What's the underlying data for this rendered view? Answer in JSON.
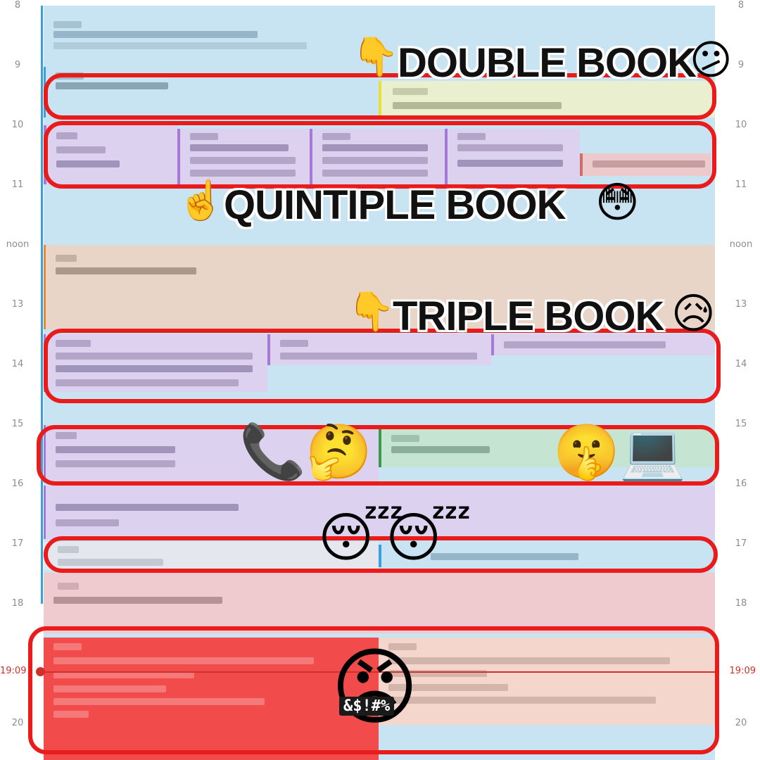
{
  "time_axis": {
    "hours": [
      "8",
      "9",
      "10",
      "11",
      "noon",
      "13",
      "14",
      "15",
      "16",
      "17",
      "18",
      "20"
    ],
    "now_label": "19:09"
  },
  "annotations": {
    "double": "DOUBLE BOOK",
    "quintiple": "QUINTIPLE BOOK",
    "triple": "TRIPLE BOOK",
    "censor": "&$!#%"
  },
  "emoji": {
    "point_down_1": "👇",
    "confused": "😕",
    "point_up": "☝️",
    "flushed": "😳",
    "point_down_2": "👇",
    "sad_sweat": "😥",
    "phone": "📞",
    "thinking": "🤔",
    "shush": "🤫",
    "laptop": "💻",
    "sleep_1": "😴",
    "sleep_2": "😴",
    "angry": "😡"
  },
  "colors": {
    "grid": "#c8e4f2",
    "highlight": "#ea1b1b",
    "now_line": "#d0302a",
    "event_red": "#f24b4b"
  }
}
